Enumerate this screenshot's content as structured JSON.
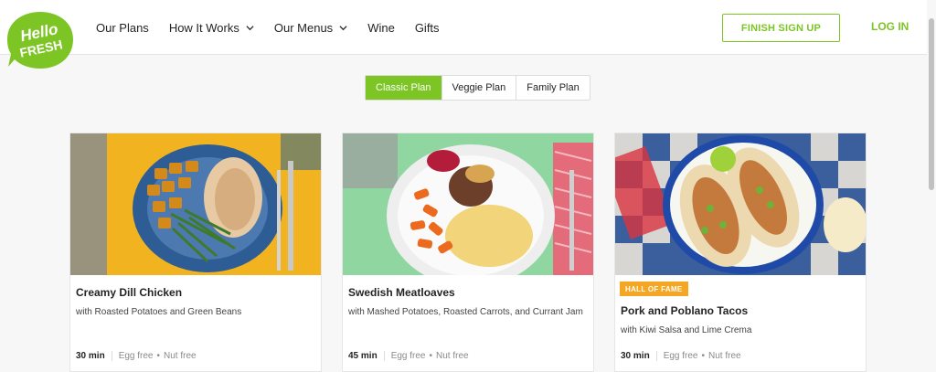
{
  "brand": {
    "logo_line1": "Hello",
    "logo_line2": "FRESH",
    "accent": "#7cc524",
    "badge_color": "#f5a623"
  },
  "nav": {
    "items": [
      {
        "label": "Our Plans"
      },
      {
        "label": "How It Works"
      },
      {
        "label": "Our Menus"
      },
      {
        "label": "Wine"
      },
      {
        "label": "Gifts"
      }
    ]
  },
  "header": {
    "finish_label": "FINISH SIGN UP",
    "login_label": "LOG IN"
  },
  "tabs": [
    {
      "label": "Classic Plan",
      "active": true
    },
    {
      "label": "Veggie Plan",
      "active": false
    },
    {
      "label": "Family Plan",
      "active": false
    }
  ],
  "recipes": [
    {
      "title": "Creamy Dill Chicken",
      "subtitle": "with Roasted Potatoes and Green Beans",
      "time": "30 min",
      "tags": [
        "Egg free",
        "Nut free"
      ],
      "badge": ""
    },
    {
      "title": "Swedish Meatloaves",
      "subtitle": "with Mashed Potatoes, Roasted Carrots, and Currant Jam",
      "time": "45 min",
      "tags": [
        "Egg free",
        "Nut free"
      ],
      "badge": ""
    },
    {
      "title": "Pork and Poblano Tacos",
      "subtitle": "with Kiwi Salsa and Lime Crema",
      "time": "30 min",
      "tags": [
        "Egg free",
        "Nut free"
      ],
      "badge": "HALL OF FAME"
    }
  ]
}
